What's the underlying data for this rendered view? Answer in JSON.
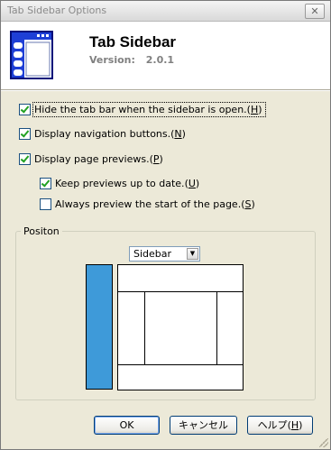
{
  "window": {
    "title": "Tab Sidebar Options",
    "close_glyph": "✕"
  },
  "header": {
    "icon": "tab-sidebar-app-icon",
    "title": "Tab Sidebar",
    "version_label": "Version:",
    "version_value": "2.0.1"
  },
  "options": [
    {
      "label": "Hide the tab bar when the sidebar is open.",
      "key": "H",
      "checked": true
    },
    {
      "label": "Display navigation buttons.",
      "key": "N",
      "checked": true
    },
    {
      "label": "Display page previews.",
      "key": "P",
      "checked": true
    },
    {
      "label": "Keep previews up to date.",
      "key": "U",
      "checked": true
    },
    {
      "label": "Always preview the start of the page.",
      "key": "S",
      "checked": false
    }
  ],
  "position": {
    "legend": "Positon",
    "selected": "Sidebar",
    "sidebar_color": "#3e9ad9"
  },
  "buttons": {
    "ok": "OK",
    "cancel": "キャンセル",
    "help_label": "ヘルプ",
    "help_key": "H"
  }
}
